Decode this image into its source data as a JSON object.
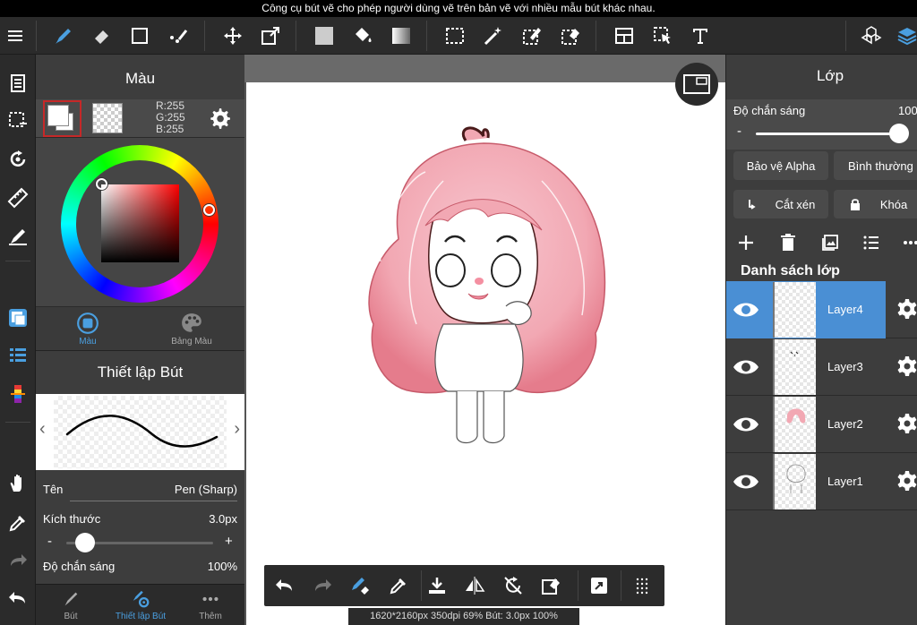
{
  "tooltip": "Công cụ bút vẽ cho phép người dùng vẽ trên bản vẽ với nhiều mẫu bút khác nhau.",
  "colors": {
    "accent": "#4a8fd4",
    "panel": "#3d3d3d",
    "toolbar": "#2b2b2b",
    "selected_border": "#c62828"
  },
  "toolbar": {
    "items": [
      "menu-icon",
      "pen-icon",
      "eraser-icon",
      "rectangle-icon",
      "select-pen-icon",
      "move-icon",
      "transform-icon",
      "fill-color-icon",
      "bucket-icon",
      "gradient-icon",
      "select-rect-icon",
      "magic-wand-icon",
      "select-pen-tool-icon",
      "select-eraser-icon",
      "layer-layout-icon",
      "select-arrow-icon",
      "text-icon",
      "material-icon",
      "layers-icon"
    ]
  },
  "color_panel": {
    "title": "Màu",
    "rgb": {
      "r": "R:255",
      "g": "G:255",
      "b": "B:255"
    },
    "tabs": [
      {
        "label": "Màu",
        "icon": "color-circle-icon"
      },
      {
        "label": "Bảng Màu",
        "icon": "palette-icon"
      }
    ]
  },
  "brush_panel": {
    "title": "Thiết lập Bút",
    "name_label": "Tên",
    "name_value": "Pen (Sharp)",
    "size_label": "Kích thước",
    "size_value": "3.0px",
    "size_fraction": 0.06,
    "minus": "-",
    "plus": "+",
    "opacity_label": "Độ chắn sáng",
    "opacity_value": "100%"
  },
  "bottom_left_tabs": [
    {
      "label": "Bút",
      "icon": "brush-icon"
    },
    {
      "label": "Thiết lập Bút",
      "icon": "brush-settings-icon"
    },
    {
      "label": "Thêm",
      "icon": "more-icon"
    }
  ],
  "canvas": {
    "status": "1620*2160px 350dpi 69% Bút: 3.0px 100%"
  },
  "bottom_bar": {
    "items": [
      "undo-icon",
      "redo-icon",
      "pen-eraser-toggle-icon",
      "eyedropper-icon",
      "save-icon",
      "flip-icon",
      "rotate-icon",
      "clear-icon",
      "share-icon",
      "grid-icon"
    ]
  },
  "layer_panel": {
    "title": "Lớp",
    "opacity_label": "Độ chắn sáng",
    "opacity_value": "100",
    "opacity_minus": "-",
    "protect_alpha": "Bảo vệ Alpha",
    "blend_mode": "Bình thường",
    "clipping": "Cắt xén",
    "lock": "Khóa",
    "list_title": "Danh sách lớp",
    "layers": [
      {
        "name": "Layer4",
        "active": true
      },
      {
        "name": "Layer3"
      },
      {
        "name": "Layer2"
      },
      {
        "name": "Layer1"
      }
    ]
  }
}
